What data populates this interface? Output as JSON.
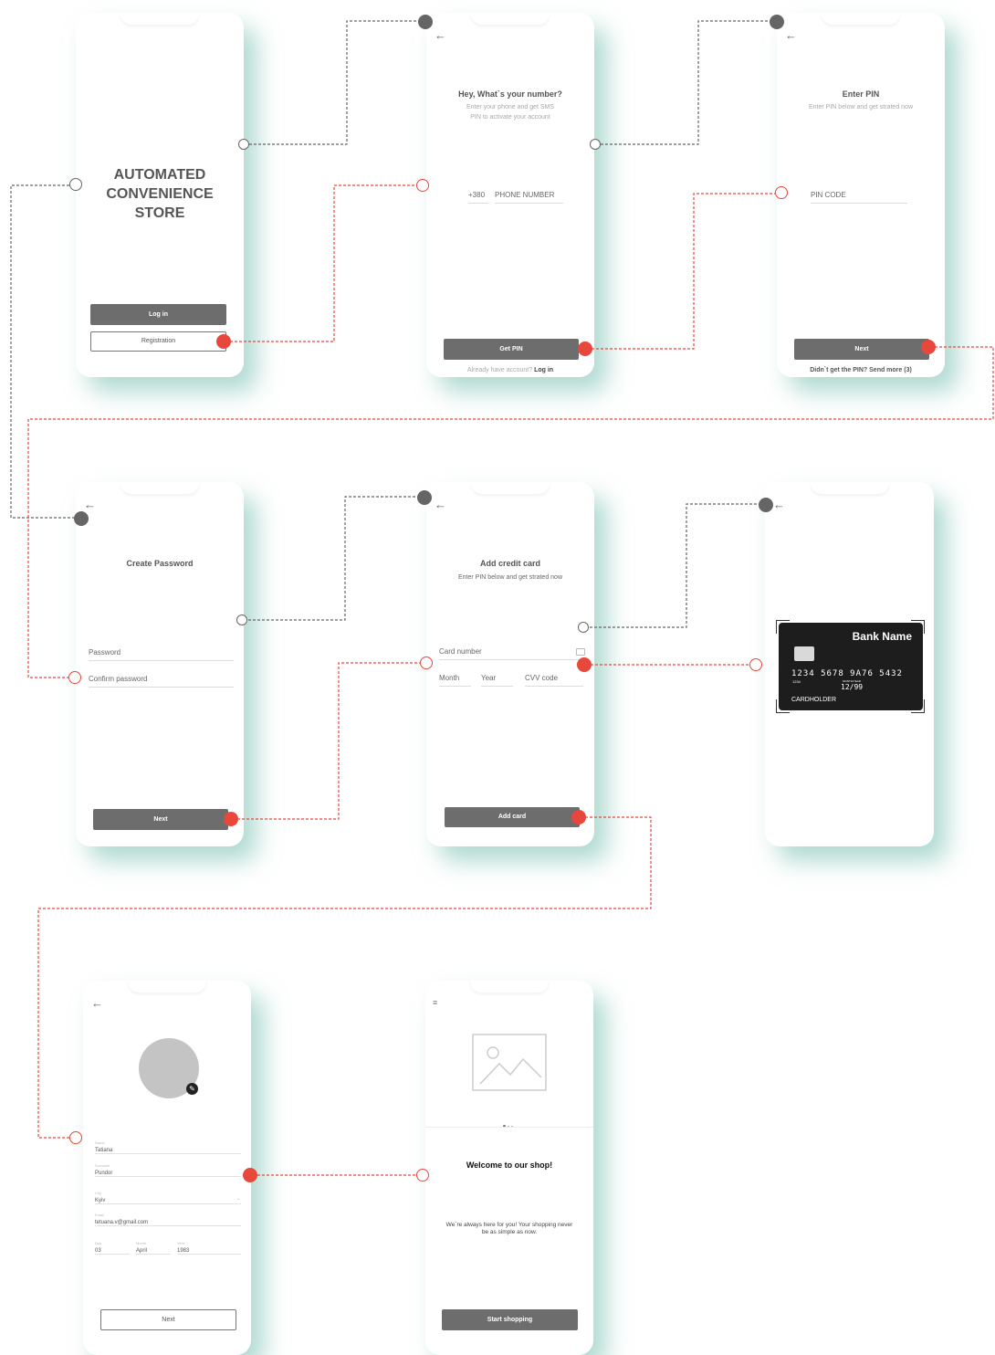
{
  "colors": {
    "accent_red": "#e8473c",
    "connector_gray": "#666666",
    "button_dark": "#6d6d6d",
    "card_black": "#1d1d1d",
    "shadow_teal": "#9fd3c7"
  },
  "screens": {
    "splash": {
      "title_line1": "AUTOMATED",
      "title_line2": "CONVENIENCE",
      "title_line3": "STORE",
      "login_label": "Log in",
      "registration_label": "Registration"
    },
    "phone_entry": {
      "back_icon": "arrow-left",
      "title": "Hey, What`s your number?",
      "subtitle": "Enter your phone and get SMS PIN to activate your account",
      "country_code": "+380",
      "phone_placeholder": "PHONE NUMBER",
      "button_label": "Get PIN",
      "footer_text": "Already have account?",
      "footer_link": "Log in"
    },
    "pin_entry": {
      "back_icon": "arrow-left",
      "title": "Enter PIN",
      "subtitle": "Enter PIN below and get strated now",
      "pin_placeholder": "PIN CODE",
      "button_label": "Next",
      "footer_text": "Didn`t get the PIN? Send more (3)"
    },
    "create_password": {
      "back_icon": "arrow-left",
      "title": "Create Password",
      "password_placeholder": "Password",
      "confirm_placeholder": "Confirm password",
      "button_label": "Next"
    },
    "add_card": {
      "back_icon": "arrow-left",
      "title": "Add credit card",
      "subtitle": "Enter PIN below and get strated now",
      "card_number_placeholder": "Card number",
      "month_placeholder": "Month",
      "year_placeholder": "Year",
      "cvv_placeholder": "CVV code",
      "button_label": "Add card",
      "camera_icon": "camera"
    },
    "card_scan": {
      "back_icon": "arrow-left",
      "bank_name": "Bank Name",
      "card_number": "1234 5678 9A76 5432",
      "card_small_number": "1234",
      "valid_label": "MONTH/YEAR",
      "valid_prefix": "VALID THRU",
      "expiry": "12/99",
      "cardholder": "CARDHOLDER"
    },
    "profile": {
      "back_icon": "arrow-left",
      "edit_icon": "pencil",
      "name_label": "Name",
      "name_value": "Tatiana",
      "surname_label": "Surname",
      "surname_value": "Pundor",
      "city_label": "City",
      "city_value": "Kyiv",
      "email_label": "Email",
      "email_value": "tetuana.v@gmail.com",
      "day_label": "Day",
      "day_value": "03",
      "month_label": "Month",
      "month_value": "April",
      "year_label": "Year",
      "year_value": "1983",
      "button_label": "Next"
    },
    "welcome": {
      "menu_icon": "hamburger",
      "image_icon": "image-placeholder",
      "title": "Welcome to our shop!",
      "text": "We`re always here for you! Your shopping never be as simple as now.",
      "button_label": "Start shopping"
    }
  }
}
